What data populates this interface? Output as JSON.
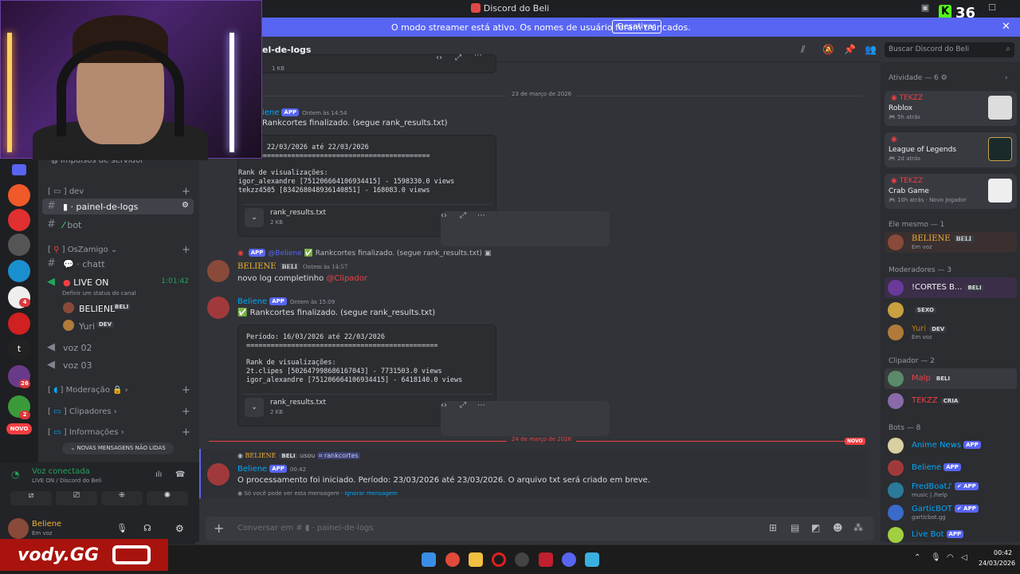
{
  "window": {
    "title": "Discord do Beli",
    "kick_count": "36"
  },
  "banner": {
    "text": "O modo streamer está ativo. Os nomes de usuário foram truncados.",
    "button": "Desativar"
  },
  "header": {
    "channel": "el-de-logs",
    "search_placeholder": "Buscar Discord do Beli"
  },
  "sidebar": {
    "boost": "Impulsos de servidor",
    "cat_dev": "dev",
    "channels_dev": [
      {
        "name": "painel-de-logs"
      },
      {
        "name": "bot"
      }
    ],
    "cat_oszamigo": "OsZamigo",
    "chat": "chatt",
    "live": {
      "name": "LIVE ON",
      "timer": "1:01:42",
      "status": "Definir um status do canal"
    },
    "voice_users": [
      {
        "name": "BELIENE",
        "tag": "BELI"
      },
      {
        "name": "Yuri",
        "tag": "DEV"
      }
    ],
    "voice2": "voz 02",
    "voice3": "voz 03",
    "cat_moderacao": "Moderação",
    "cat_clipadores": "Clipadores",
    "cat_info": "Informações",
    "unread_pill": "NOVAS MENSAGENS NÃO LIDAS",
    "novo": "NOVO"
  },
  "voice_panel": {
    "status": "Voz conectada",
    "channel": "LIVE ON / Discord do Beli"
  },
  "user_panel": {
    "name": "Beliene",
    "status": "Em voz"
  },
  "messages": {
    "m0": {
      "file_size": "1 KB"
    },
    "date1": "23 de março de 2026",
    "m1": {
      "author": "iene",
      "badge": "APP",
      "time": "Ontem às 14:54",
      "text": "Rankcortes finalizado. (segue rank_results.txt)",
      "code": "ríodo: 22/03/2026 até 22/03/2026\n===============================================\n\nRank de visualizações:\nigor_alexandre [751206664106934415] - 1598330.0 views\ntekzz4505 [834268048936140851] - 168083.0 views",
      "file": "rank_results.txt",
      "file_size": "2 KB"
    },
    "m2": {
      "reply_badge": "APP",
      "reply_user": "@Beliene",
      "reply_text": "Rankcortes finalizado. (segue rank_results.txt)",
      "author": "BELIENE",
      "tag": "BELI",
      "time": "Ontem às 14:57",
      "text": "novo log completinho",
      "mention": "@Clipador"
    },
    "m3": {
      "author": "Beliene",
      "badge": "APP",
      "time": "Ontem às 15:09",
      "text": "✅ Rankcortes finalizado. (segue rank_results.txt)",
      "code": "Período: 16/03/2026 até 22/03/2026\n===============================================\n\nRank de visualizações:\n2t.clipes [502647998686167043] - 7731503.0 views\nigor_alexandre [751206664106934415] - 6418140.0 views",
      "file": "rank_results.txt",
      "file_size": "2 KB"
    },
    "date2": "24 de março de 2026",
    "novo": "NOVO",
    "m4": {
      "cmd_user": "BELIENE",
      "cmd_tag": "BELI",
      "cmd_used": "usou",
      "cmd": "rankcortes",
      "author": "Beliene",
      "badge": "APP",
      "time": "00:42",
      "text": "O processamento foi iniciado. Período: 23/03/2026 até 23/03/2026. O arquivo txt será criado em breve.",
      "ephemeral": "Só você pode ver esta mensagem",
      "dismiss": "Ignorar mensagem"
    }
  },
  "composer": {
    "placeholder": "Conversar em #",
    "channel": "painel-de-logs"
  },
  "members": {
    "activity_head": "Atividade — 6",
    "activities": [
      {
        "user": "TEKZZ",
        "game": "Roblox",
        "time": "5h atrás",
        "extra": ""
      },
      {
        "user": "",
        "game": "League of Legends",
        "time": "2d atrás",
        "extra": ""
      },
      {
        "user": "TEKZZ",
        "game": "Crab Game",
        "time": "10h atrás",
        "extra": "Novo Jogador"
      }
    ],
    "g1": "Ele mesmo — 1",
    "g2": "Moderadores — 3",
    "g3": "Clipador — 2",
    "g4": "Bots — 8",
    "list": [
      {
        "name": "BELIENE",
        "tag": "BELI",
        "status": "Em voz",
        "color": "#f0b232"
      },
      {
        "name": "!CORTES B...",
        "tag": "BELI",
        "status": "",
        "color": "#f2f3f5"
      },
      {
        "name": "",
        "tag": "SEXO",
        "status": "",
        "color": "#f2f3f5"
      },
      {
        "name": "Yuri",
        "tag": "DEV",
        "status": "Em voz",
        "color": "#c27c0e"
      },
      {
        "name": "Malp",
        "tag": "BELI",
        "status": "",
        "color": "#f23f43"
      },
      {
        "name": "TEKZZ",
        "tag": "CRIA",
        "status": "",
        "color": "#f23f43"
      },
      {
        "name": "Anime News",
        "tag": "APP",
        "status": "",
        "color": "#00a8fc"
      },
      {
        "name": "Beliene",
        "tag": "APP",
        "status": "",
        "color": "#00a8fc"
      },
      {
        "name": "FredBoat♪",
        "tag": "✔ APP",
        "status": "music | /help",
        "color": "#00a8fc"
      },
      {
        "name": "GarticBOT",
        "tag": "✔ APP",
        "status": "garticbot.gg",
        "color": "#00a8fc"
      },
      {
        "name": "Live Bot",
        "tag": "APP",
        "status": "",
        "color": "#00a8fc"
      }
    ]
  },
  "taskbar": {
    "time": "00:42",
    "date": "24/03/2026"
  },
  "overlay": {
    "brand": "vody.GG"
  }
}
